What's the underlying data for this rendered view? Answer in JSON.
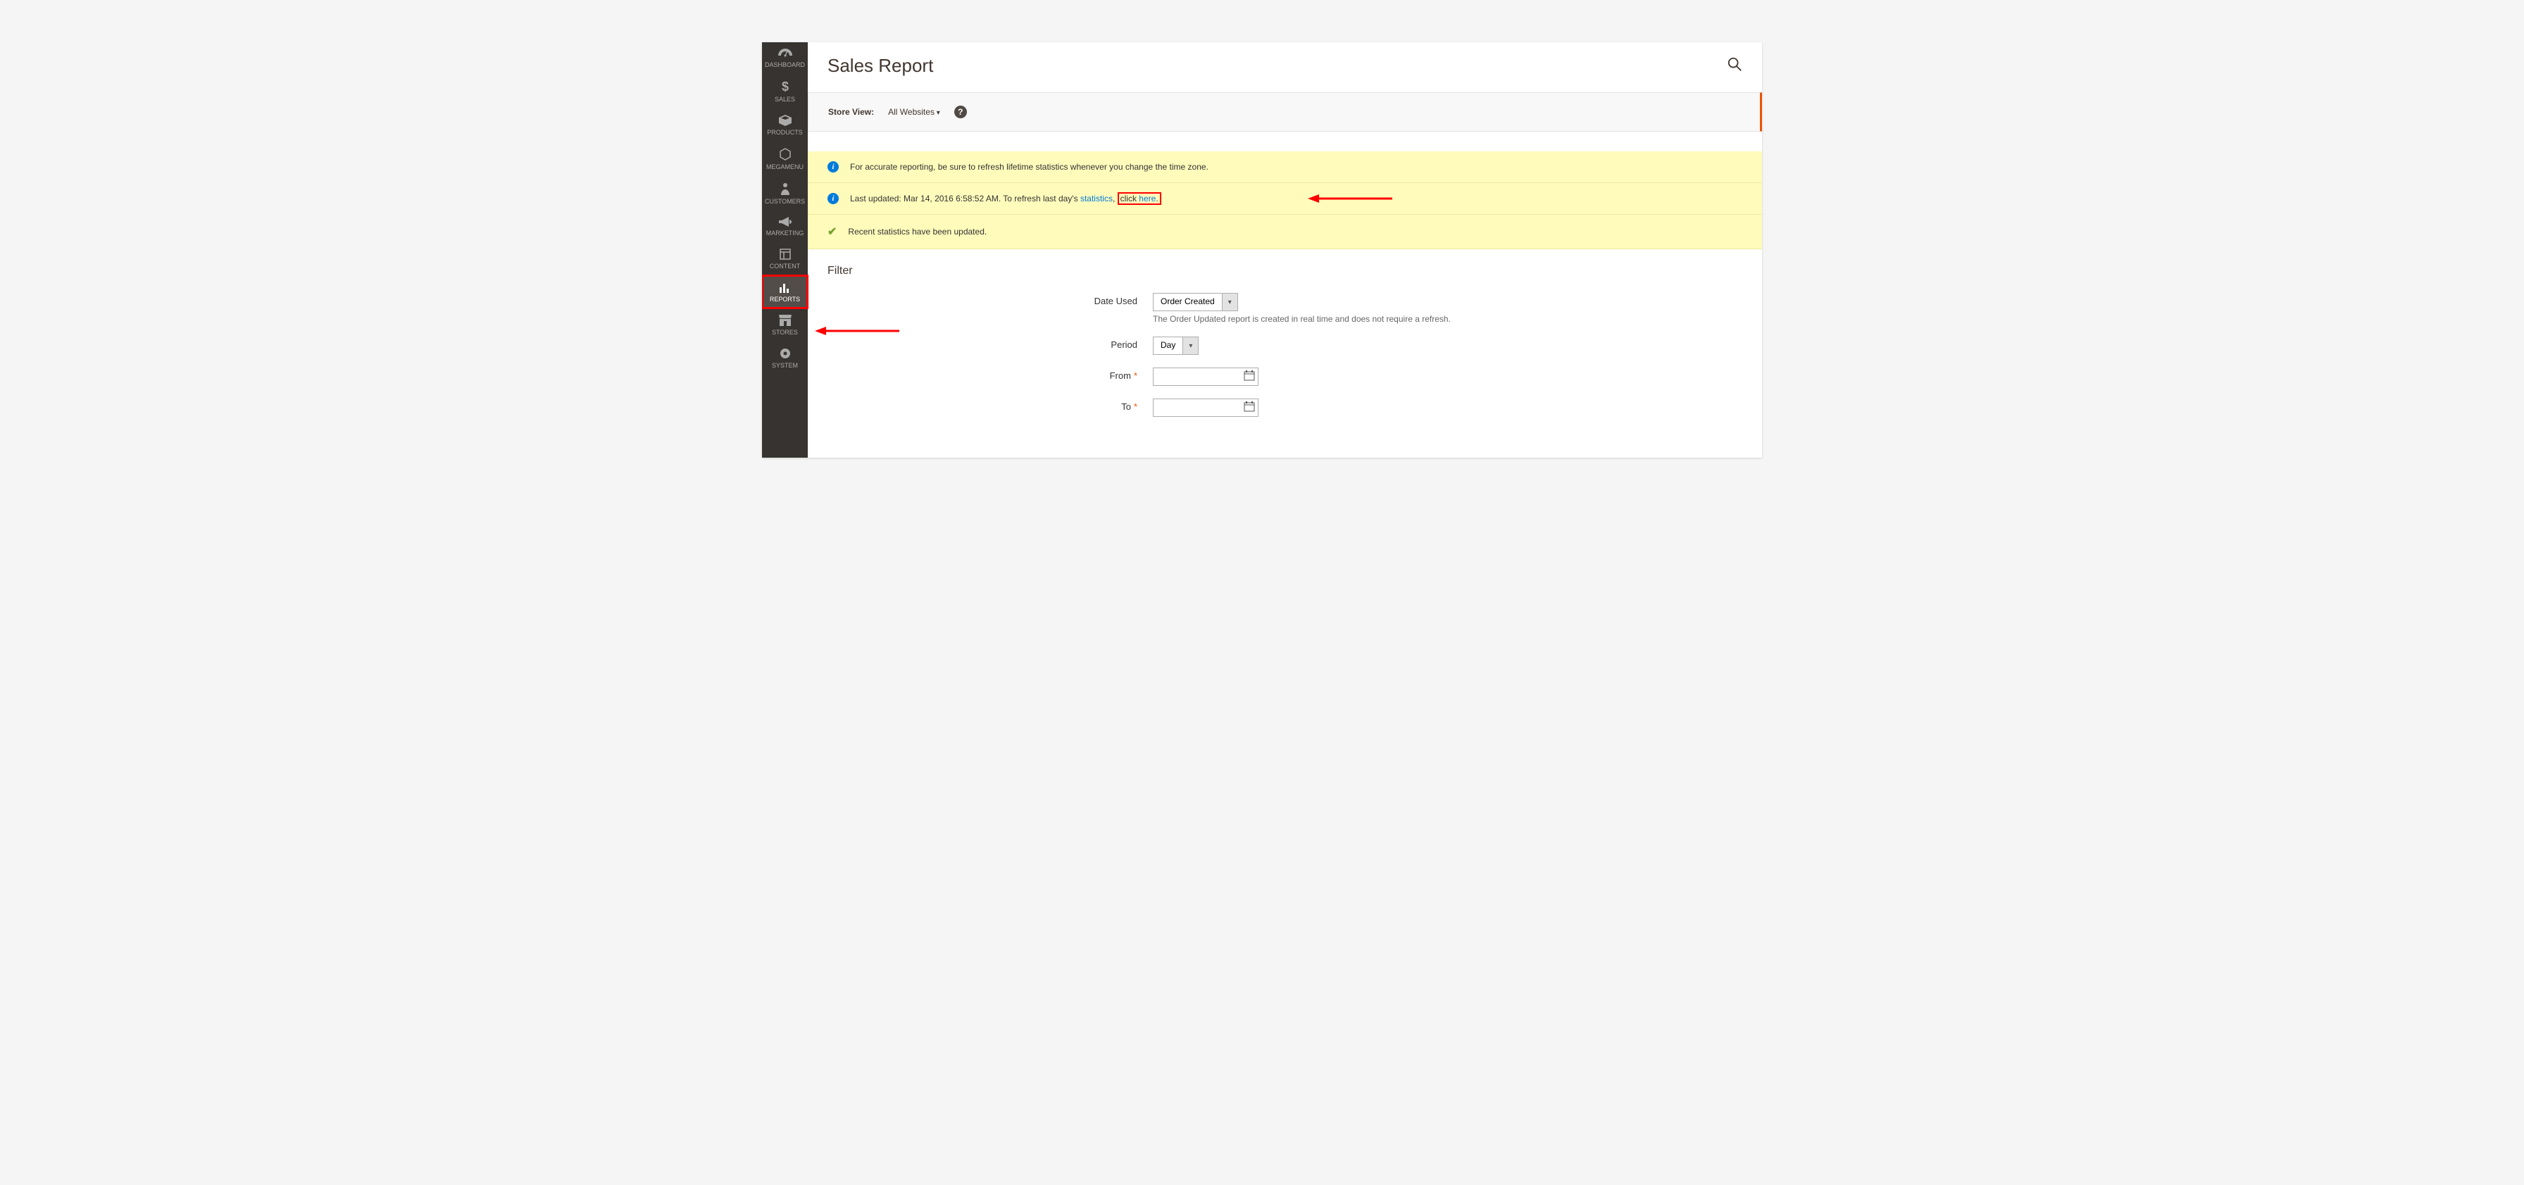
{
  "sidebar": {
    "items": [
      {
        "label": "DASHBOARD",
        "icon": "gauge"
      },
      {
        "label": "SALES",
        "icon": "dollar"
      },
      {
        "label": "PRODUCTS",
        "icon": "box"
      },
      {
        "label": "MEGAMENU",
        "icon": "hexagon"
      },
      {
        "label": "CUSTOMERS",
        "icon": "person"
      },
      {
        "label": "MARKETING",
        "icon": "megaphone"
      },
      {
        "label": "CONTENT",
        "icon": "layout"
      },
      {
        "label": "REPORTS",
        "icon": "bars"
      },
      {
        "label": "STORES",
        "icon": "storefront"
      },
      {
        "label": "SYSTEM",
        "icon": "gear"
      }
    ]
  },
  "header": {
    "title": "Sales Report"
  },
  "scope": {
    "label": "Store View:",
    "value": "All Websites"
  },
  "messages": {
    "info1": "For accurate reporting, be sure to refresh lifetime statistics whenever you change the time zone.",
    "info2_a": "Last updated: Mar 14, 2016 6:58:52 AM. To refresh last day's ",
    "info2_link1": "statistics",
    "info2_b": ", ",
    "info2_boxed_a": "click ",
    "info2_boxed_link": "here",
    "info2_boxed_b": ".",
    "success": "Recent statistics have been updated."
  },
  "filter": {
    "title": "Filter",
    "date_used_label": "Date Used",
    "date_used_value": "Order Created",
    "date_used_note": "The Order Updated report is created in real time and does not require a refresh.",
    "period_label": "Period",
    "period_value": "Day",
    "from_label": "From",
    "to_label": "To",
    "required_mark": "*"
  }
}
